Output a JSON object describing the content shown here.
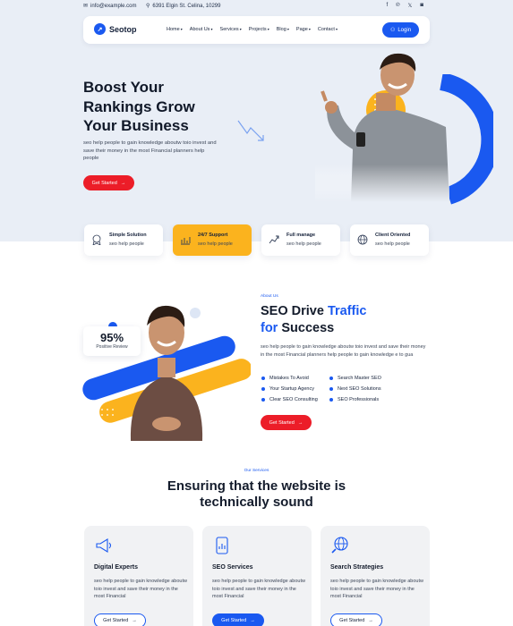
{
  "topbar": {
    "email": "info@example.com",
    "address": "6391 Elgin St. Celina, 10299",
    "social": [
      "f",
      "℗",
      "𝕏",
      "◙"
    ]
  },
  "nav": {
    "logo": "Seotop",
    "menu": [
      "Home",
      "About Us",
      "Services",
      "Projects",
      "Blog",
      "Page",
      "Contact"
    ],
    "login": "Login"
  },
  "hero": {
    "title_line1": "Boost Your",
    "title_line2": "Rankings Grow",
    "title_line3": "Your Business",
    "desc": "seo help people to gain knowledge aboutw toio invest and save their money in the most Financial planners help people",
    "cta": "Get Started"
  },
  "features": [
    {
      "title": "Simple Solution",
      "sub": "seo help people",
      "icon": "ribbon-icon"
    },
    {
      "title": "24/7 Support",
      "sub": "seo help people",
      "icon": "chart-icon"
    },
    {
      "title": "Full manage",
      "sub": "seo help people",
      "icon": "growth-icon"
    },
    {
      "title": "Client Oriented",
      "sub": "seo help people",
      "icon": "globe-icon"
    }
  ],
  "about": {
    "tag": "About Us",
    "title_a": "SEO Drive ",
    "title_b": "Traffic",
    "title_c": "for",
    "title_d": " Success",
    "desc": "seo help people to gain knowledge aboutw toio invest and save their money in the most Financial planners help people to gain knowledge e to gua",
    "list_left": [
      "Mistakes To Avoid",
      "Your Startup Agency",
      "Clear SEO Consulting"
    ],
    "list_right": [
      "Search Master SEO",
      "Next SEO Solutions",
      "SEO Professionals"
    ],
    "cta": "Get Started",
    "stat_value": "95%",
    "stat_label": "Positive Review"
  },
  "services": {
    "tag": "Our Services",
    "title_line1": "Ensuring that the website is",
    "title_line2": "technically sound",
    "cards": [
      {
        "title": "Digital Experts",
        "desc": "seo help people to gain knowledge aboutw toio invest and save their money in the most Financial",
        "cta": "Get Started",
        "icon": "megaphone-icon"
      },
      {
        "title": "SEO Services",
        "desc": "seo help people to gain knowledge aboutw toio invest and save their money in the most Financial",
        "cta": "Get Started",
        "icon": "phone-chart-icon"
      },
      {
        "title": "Search Strategies",
        "desc": "seo help people to gain knowledge aboutw toio invest and save their money in the most Financial",
        "cta": "Get Started",
        "icon": "globe-search-icon"
      }
    ]
  },
  "colors": {
    "primary": "#1a59f0",
    "accent_red": "#ec1d28",
    "accent_yellow": "#fbb31e",
    "hero_bg": "#e9eef6"
  }
}
